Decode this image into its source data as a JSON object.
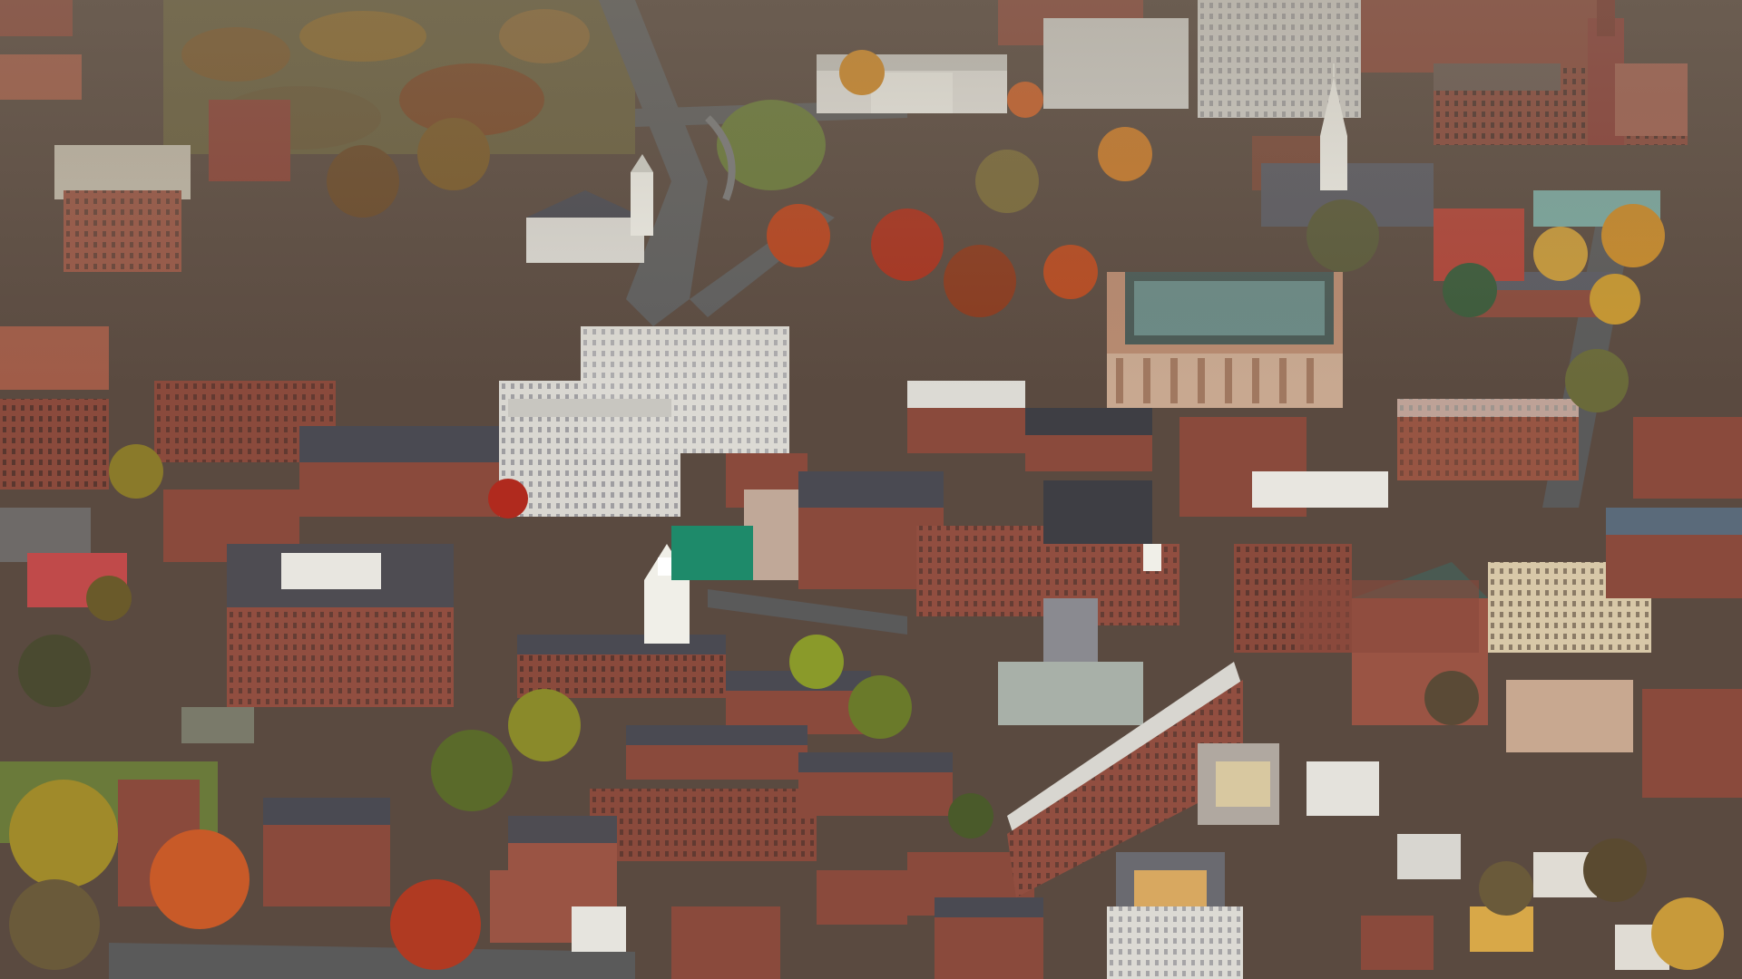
{
  "photo": {
    "subject": "aerial-campus-view",
    "palette": {
      "brick": "#8a4a3c",
      "brick_dark": "#6e3a30",
      "brick_light": "#a5604c",
      "slate_roof": "#4a4a52",
      "concrete": "#c8c6c0",
      "white_stone": "#e6e4de",
      "autumn_orange": "#c86a2a",
      "autumn_red": "#a8321e",
      "autumn_yellow": "#c8a032",
      "tree_green": "#5a6a32",
      "lawn": "#6a7a3a",
      "road": "#5a5a5a",
      "copper_roof": "#6ea89c",
      "tower_white": "#f0efe8"
    }
  }
}
